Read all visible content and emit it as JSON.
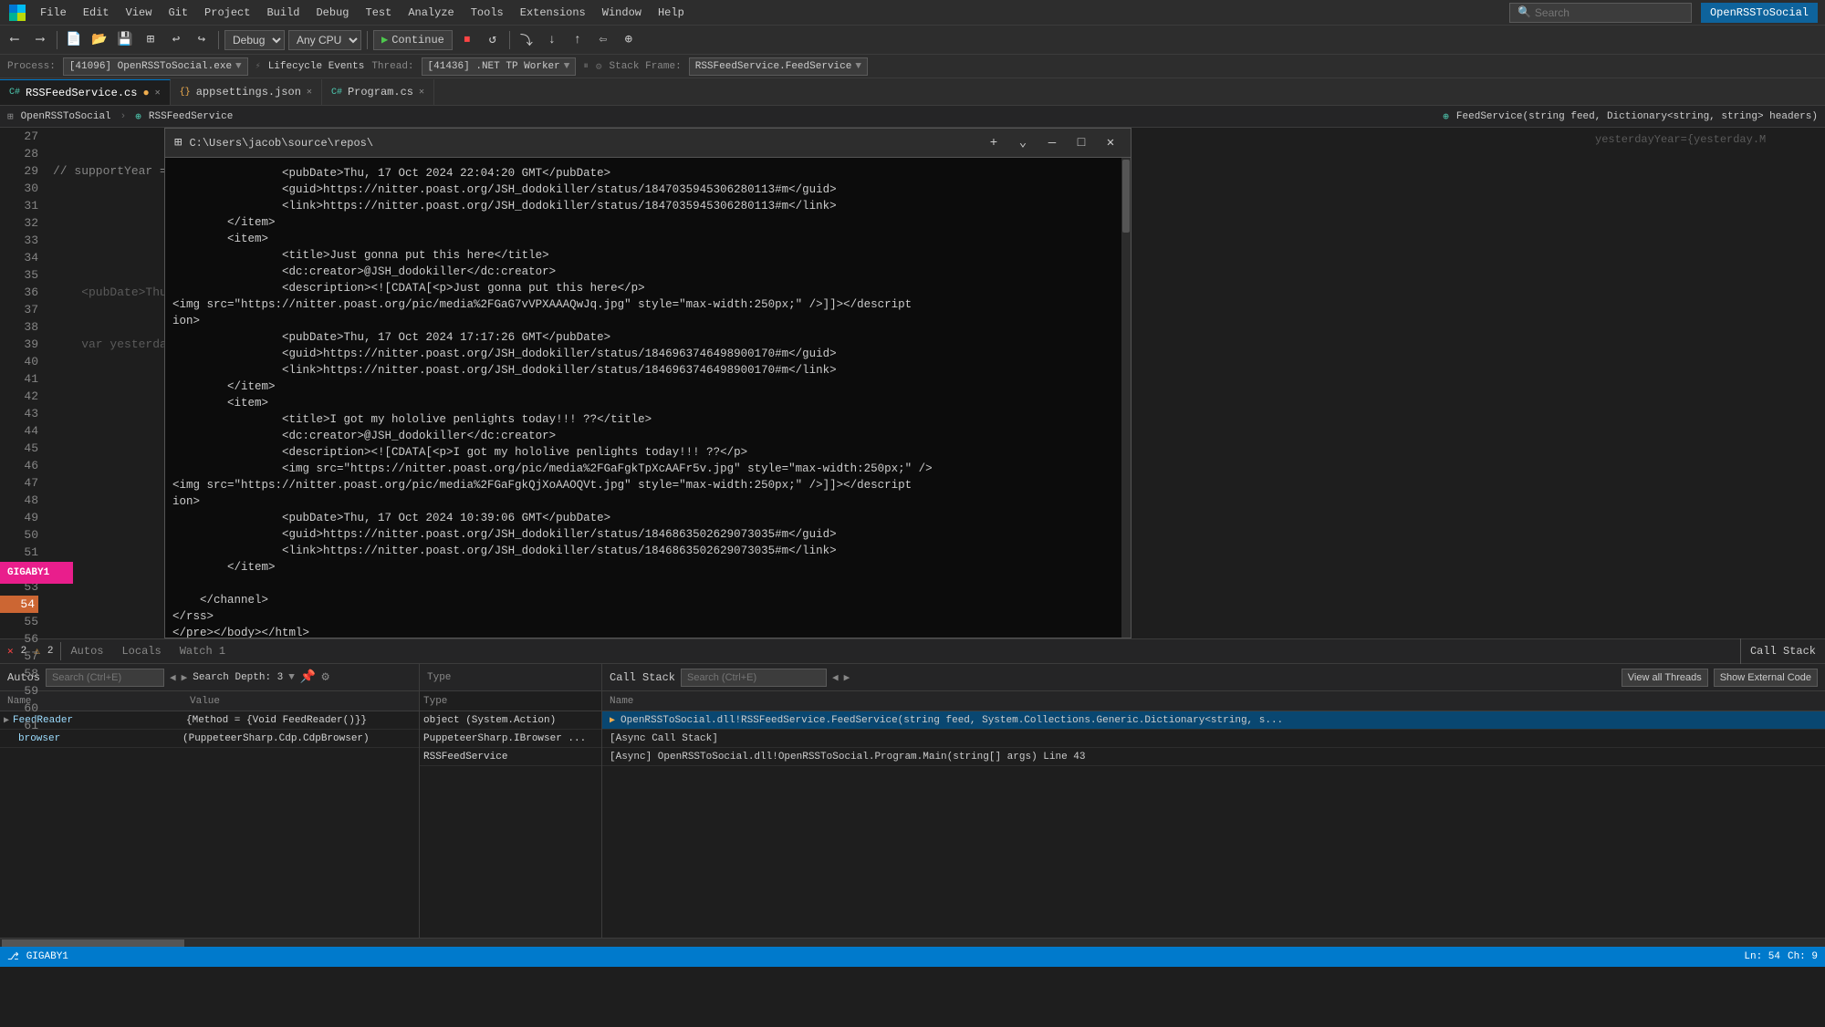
{
  "menubar": {
    "items": [
      "File",
      "Edit",
      "View",
      "Git",
      "Project",
      "Build",
      "Debug",
      "Test",
      "Analyze",
      "Tools",
      "Extensions",
      "Window",
      "Help"
    ],
    "search_placeholder": "Search",
    "openrss_label": "OpenRSSToSocial"
  },
  "toolbar": {
    "debug_config": "Debug",
    "platform": "Any CPU",
    "continue_label": "Continue"
  },
  "process_bar": {
    "process_label": "Process:",
    "process_value": "[41096] OpenRSSToSocial.exe",
    "lifecycle_label": "Lifecycle Events",
    "thread_label": "Thread:",
    "thread_value": "[41436] .NET TP Worker",
    "stack_frame_label": "Stack Frame:",
    "stack_frame_value": "RSSFeedService.FeedService"
  },
  "tabs": [
    {
      "label": "RSSFeedService.cs",
      "active": true,
      "modified": true
    },
    {
      "label": "appsettings.json",
      "active": false,
      "modified": false
    },
    {
      "label": "Program.cs",
      "active": false,
      "modified": false
    }
  ],
  "editor_info": {
    "project": "OpenRSSToSocial",
    "class": "RSSFeedService",
    "method": "FeedService(string feed, Dictionary<string, string> headers)"
  },
  "terminal": {
    "title": "C:\\Users\\jacob\\source\\repos\\",
    "content": [
      "                &lt;pubDate&gt;Thu, 17 Oct 2024 22:04:20 GMT&lt;/pubDate&gt;",
      "                &lt;guid&gt;https://nitter.poast.org/JSH_dodokiller/status/1847035945306280113#m&lt;/guid&gt;",
      "                &lt;link&gt;https://nitter.poast.org/JSH_dodokiller/status/1847035945306280113#m&lt;/link&gt;",
      "        &lt;/item&gt;",
      "        &lt;item&gt;",
      "                &lt;title&gt;Just gonna put this here&lt;/title&gt;",
      "                &lt;dc:creator&gt;@JSH_dodokiller&lt;/dc:creator&gt;",
      "                &lt;description&gt;&lt;![CDATA[&lt;p&gt;Just gonna put this here&lt;/p&gt;",
      "&lt;img src=\"https://nitter.poast.org/pic/media%2FGaG7vVPXAAAQwJq.jpg\" style=\"max-width:250px;\" /&gt;]]&gt;&lt;/description&gt;",
      "                &lt;pubDate&gt;Thu, 17 Oct 2024 17:17:26 GMT&lt;/pubDate&gt;",
      "                &lt;guid&gt;https://nitter.poast.org/JSH_dodokiller/status/1846963746498900170#m&lt;/guid&gt;",
      "                &lt;link&gt;https://nitter.poast.org/JSH_dodokiller/status/1846963746498900170#m&lt;/link&gt;",
      "        &lt;/item&gt;",
      "        &lt;item&gt;",
      "                &lt;title&gt;I got my hololive penlights today!!! ??&lt;/title&gt;",
      "                &lt;dc:creator&gt;@JSH_dodokiller&lt;/dc:creator&gt;",
      "                &lt;description&gt;&lt;![CDATA[&lt;p&gt;I got my hololive penlights today!!! ??&lt;/p&gt;",
      "                &lt;img src=\"https://nitter.poast.org/pic/media%2FGaFgkTpXcAAFr5v.jpg\" style=\"max-width:250px;\" /&gt;",
      "&lt;img src=\"https://nitter.poast.org/pic/media%2FGaFgkQjXoAAOQVt.jpg\" style=\"max-width:250px;\" /&gt;]]&gt;&lt;/description&gt;",
      "                &lt;pubDate&gt;Thu, 17 Oct 2024 10:39:06 GMT&lt;/pubDate&gt;",
      "                &lt;guid&gt;https://nitter.poast.org/JSH_dodokiller/status/1846863502629073035#m&lt;/guid&gt;",
      "                &lt;link&gt;https://nitter.poast.org/JSH_dodokiller/status/1846863502629073035#m&lt;/link&gt;",
      "        &lt;/item&gt;",
      "",
      "    &lt;/channel&gt;",
      "&lt;/rss&gt;",
      "&lt;/pre&gt;&lt;/body&gt;&lt;/html&gt;"
    ]
  },
  "line_numbers": {
    "start": 27,
    "end": 61
  },
  "debug_panel_tabs": [
    "Autos",
    "Locals",
    "Watch 1"
  ],
  "autos": {
    "search_placeholder": "Search (Ctrl+E)",
    "search_depth_label": "Search Depth:",
    "search_depth_value": "3",
    "columns": [
      "Name",
      "Value"
    ],
    "rows": [
      {
        "name": "FeedReader",
        "value": "{Method = {Void FeedReader()}}",
        "expanded": true
      },
      {
        "name": "browser",
        "value": "(PuppeteerSharp.Cdp.CdpBrowser)",
        "indent": 1
      }
    ]
  },
  "type_panel": {
    "columns": [
      "Type"
    ],
    "rows": [
      {
        "value": "object (System.Action)"
      },
      {
        "value": "PuppeteerSharp.IBrowser ..."
      },
      {
        "value": "RSSFeedService"
      }
    ]
  },
  "call_stack": {
    "search_placeholder": "Search (Ctrl+E)",
    "buttons": [
      "View all Threads",
      "Show External Code"
    ],
    "rows": [
      {
        "text": "OpenRSSToSocial.dll!RSSFeedService.FeedService(string feed, System.Collections.Generic.Dictionary<string, s...",
        "active": true
      },
      {
        "text": "[Async Call Stack]"
      },
      {
        "text": "[Async] OpenRSSToSocial.dll!OpenRSSToSocial.Program.Main(string[] args) Line 43"
      }
    ]
  },
  "status_bar": {
    "errors": "2",
    "warnings": "2",
    "branch": "GIGABY1",
    "ln": "Ln: 54",
    "ch": "Ch: 9"
  }
}
